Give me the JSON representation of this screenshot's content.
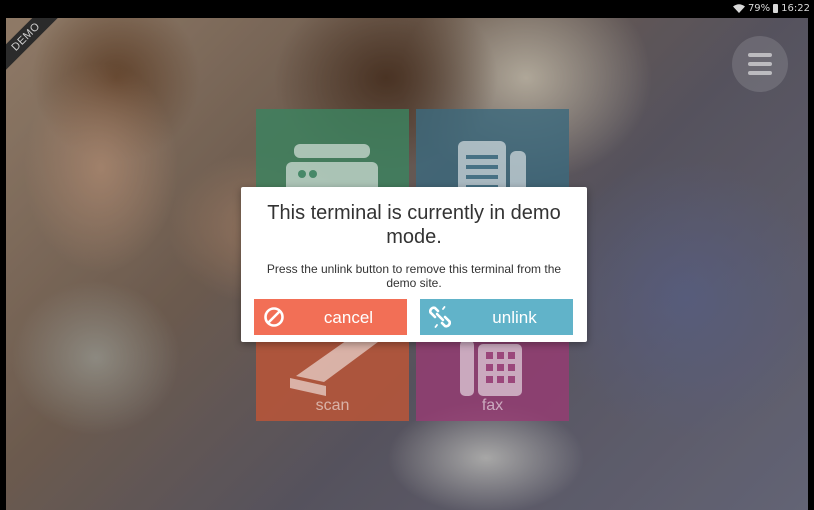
{
  "status_bar": {
    "battery": "79%",
    "time": "16:22"
  },
  "demo_ribbon": "DEMO",
  "tiles": {
    "copy": {
      "label": ""
    },
    "print": {
      "label": ""
    },
    "scan": {
      "label": "scan"
    },
    "fax": {
      "label": "fax"
    }
  },
  "dialog": {
    "title": "This terminal is currently in demo mode.",
    "message": "Press the unlink button to remove this terminal from the demo site.",
    "cancel_label": "cancel",
    "unlink_label": "unlink"
  },
  "colors": {
    "cancel": "#f26f56",
    "unlink": "#61b3c9",
    "copy_tile": "#3c825f",
    "print_tile": "#3c697d",
    "scan_tile": "#be5537",
    "fax_tile": "#963c73"
  },
  "icons": {
    "menu": "hamburger-icon",
    "cancel": "prohibited-icon",
    "unlink": "broken-link-icon",
    "copy": "copier-icon",
    "print": "document-icon",
    "scan": "scanner-icon",
    "fax": "fax-keypad-icon"
  }
}
